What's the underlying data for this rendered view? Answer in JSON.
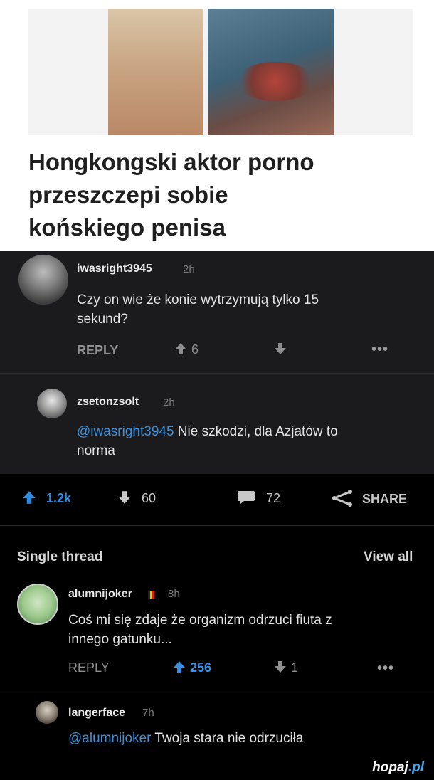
{
  "article": {
    "headline_lines": [
      "Hongkongski aktor porno",
      "przeszczepi sobie",
      "końskiego penisa"
    ]
  },
  "comment1": {
    "username": "iwasright3945",
    "time": "2h",
    "text_lines": [
      "Czy on wie że konie wytrzymują tylko 15",
      "sekund?"
    ],
    "reply_label": "REPLY",
    "upvotes": "6",
    "more": "•••"
  },
  "comment2": {
    "username": "zsetonzsolt",
    "time": "2h",
    "mention": "@iwasright3945",
    "text_line1": " Nie szkodzi, dla Azjatów to",
    "text_line2": "norma"
  },
  "post_bar": {
    "upvotes": "1.2k",
    "downvotes": "60",
    "comments": "72",
    "share_label": "SHARE"
  },
  "thread": {
    "title": "Single thread",
    "view_all": "View all"
  },
  "comment3": {
    "username": "alumnijoker",
    "time": "8h",
    "text_lines": [
      "Coś mi się zdaje że organizm odrzuci fiuta z",
      "innego gatunku..."
    ],
    "reply_label": "REPLY",
    "upvotes": "256",
    "downvotes": "1",
    "more": "•••"
  },
  "comment4": {
    "username": "langerface",
    "time": "7h",
    "mention": "@alumnijoker",
    "text": " Twoja stara nie odrzuciła"
  },
  "watermark": {
    "brand": "hopaj",
    "tld": ".pl"
  },
  "colors": {
    "accent_blue": "#2f8de4",
    "dark_bg": "#1b1b1d",
    "page_bg": "#000000"
  }
}
